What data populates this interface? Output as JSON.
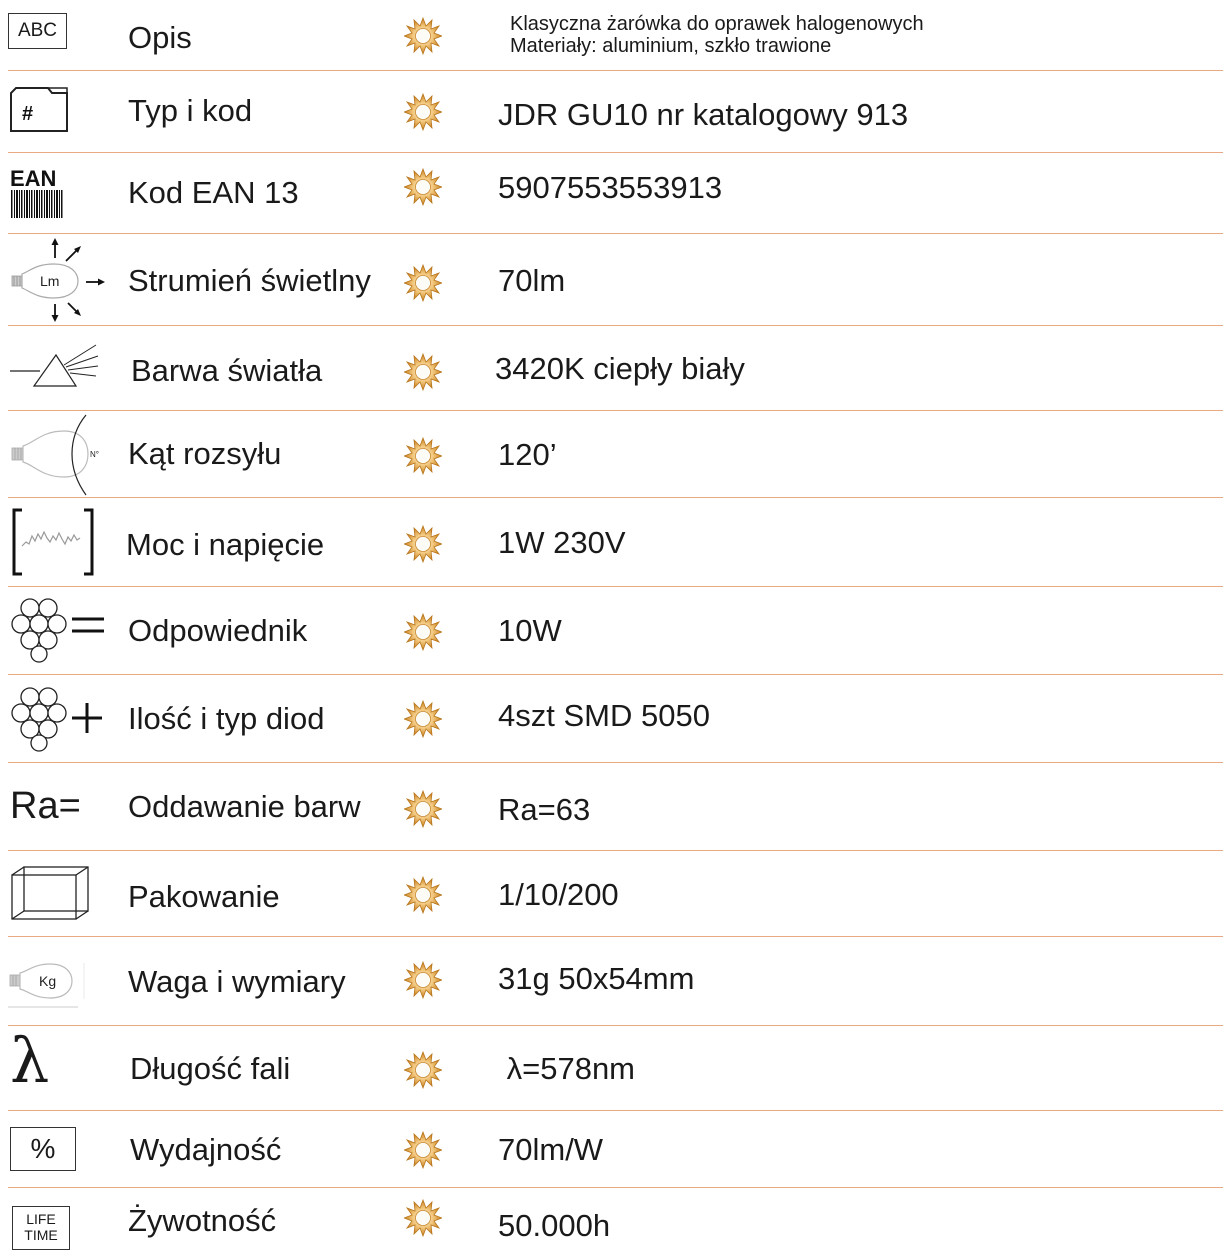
{
  "rows": [
    {
      "key": "opis",
      "icon": "abc-box-icon",
      "icon_text": "ABC",
      "label": "Opis",
      "value_lines": [
        "Klasyczna żarówka do oprawek halogenowych",
        "Materiały: aluminium, szkło trawione"
      ]
    },
    {
      "key": "typ",
      "icon": "hash-folder-icon",
      "icon_text": "#",
      "label": "Typ i kod",
      "value": "JDR GU10 nr katalogowy 913"
    },
    {
      "key": "ean",
      "icon": "ean-barcode-icon",
      "icon_text": "EAN",
      "label": "Kod EAN 13",
      "value": "5907553553913"
    },
    {
      "key": "lm",
      "icon": "lumen-bulb-icon",
      "icon_text": "Lm",
      "label": "Strumień świetlny",
      "value": "70lm"
    },
    {
      "key": "barwa",
      "icon": "prism-icon",
      "label": "Barwa światła",
      "value": "3420K ciepły biały"
    },
    {
      "key": "kat",
      "icon": "beam-angle-icon",
      "icon_text": "N°",
      "label": "Kąt rozsyłu",
      "value": "120’"
    },
    {
      "key": "moc",
      "icon": "power-waveform-icon",
      "label": "Moc i napięcie",
      "value": "1W 230V"
    },
    {
      "key": "odp",
      "icon": "leds-equal-icon",
      "label": "Odpowiednik",
      "value": "10W"
    },
    {
      "key": "diody",
      "icon": "leds-plus-icon",
      "label": "Ilość i typ diod",
      "value": "4szt SMD 5050"
    },
    {
      "key": "ra",
      "icon": "ra-icon",
      "icon_text": "Ra=",
      "label": "Oddawanie barw",
      "value": "Ra=63"
    },
    {
      "key": "pak",
      "icon": "box-icon",
      "label": "Pakowanie",
      "value": "1/10/200"
    },
    {
      "key": "waga",
      "icon": "weight-bulb-icon",
      "icon_text": "Kg",
      "label": "Waga i wymiary",
      "value": "31g 50x54mm"
    },
    {
      "key": "fala",
      "icon": "lambda-icon",
      "icon_text": "λ",
      "label": "Długość fali",
      "value": " λ=578nm"
    },
    {
      "key": "wyd",
      "icon": "percent-box-icon",
      "icon_text": "%",
      "label": "Wydajność",
      "value": "70lm/W"
    },
    {
      "key": "zyw",
      "icon": "lifetime-box-icon",
      "icon_text": [
        "LIFE",
        "TIME"
      ],
      "label": "Żywotność",
      "value": "50.000h"
    }
  ],
  "colors": {
    "separator": "#e8a882",
    "sun": "#d9941f",
    "text": "#1a1a1a"
  }
}
